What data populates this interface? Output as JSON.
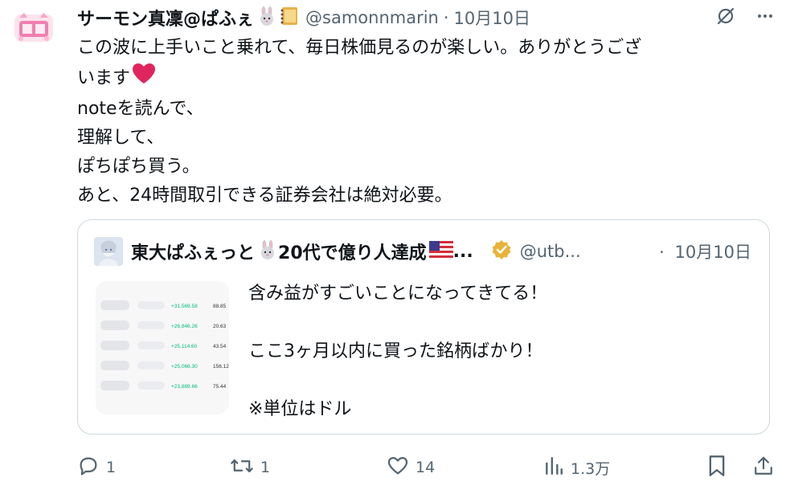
{
  "tweet": {
    "author_name": "サーモン真凜@ぱふぇ",
    "handle": "@samonnmarin",
    "separator": "·",
    "date": "10月10日",
    "lines": [
      "この波に上手いこと乗れて、毎日株価見るのが楽しい。ありがとうござ",
      "います",
      "noteを読んで、",
      "理解して、",
      "ぽちぽち買う。",
      "あと、24時間取引できる証券会社は絶対必要。"
    ]
  },
  "quote": {
    "author_name": "東大ぱふぇっと",
    "name_suffix": "20代で億り人達成",
    "ellipsis": "...",
    "handle": "@utb...",
    "separator": "·",
    "date": "10月10日",
    "lines": [
      "含み益がすごいことになってきてる！",
      "",
      "ここ3ヶ月以内に買った銘柄ばかり！",
      "",
      "※単位はドル"
    ],
    "thumbnail": {
      "rows": [
        {
          "change": "+31,569.58",
          "value": "88.85"
        },
        {
          "change": "+26,846.26",
          "value": "20.63"
        },
        {
          "change": "+25,114.60",
          "value": "43.54"
        },
        {
          "change": "+25,066.30",
          "value": "156.12"
        },
        {
          "change": "+23,889.66",
          "value": "75.44"
        }
      ]
    }
  },
  "actions": {
    "reply_count": "1",
    "retweet_count": "1",
    "like_count": "14",
    "view_count": "1.3万"
  },
  "colors": {
    "text": "#0f1419",
    "secondary": "#536471",
    "border": "#cfd9de",
    "heart": "#e0245e",
    "verified": "#e8b339",
    "gain": "#00ba7c"
  }
}
